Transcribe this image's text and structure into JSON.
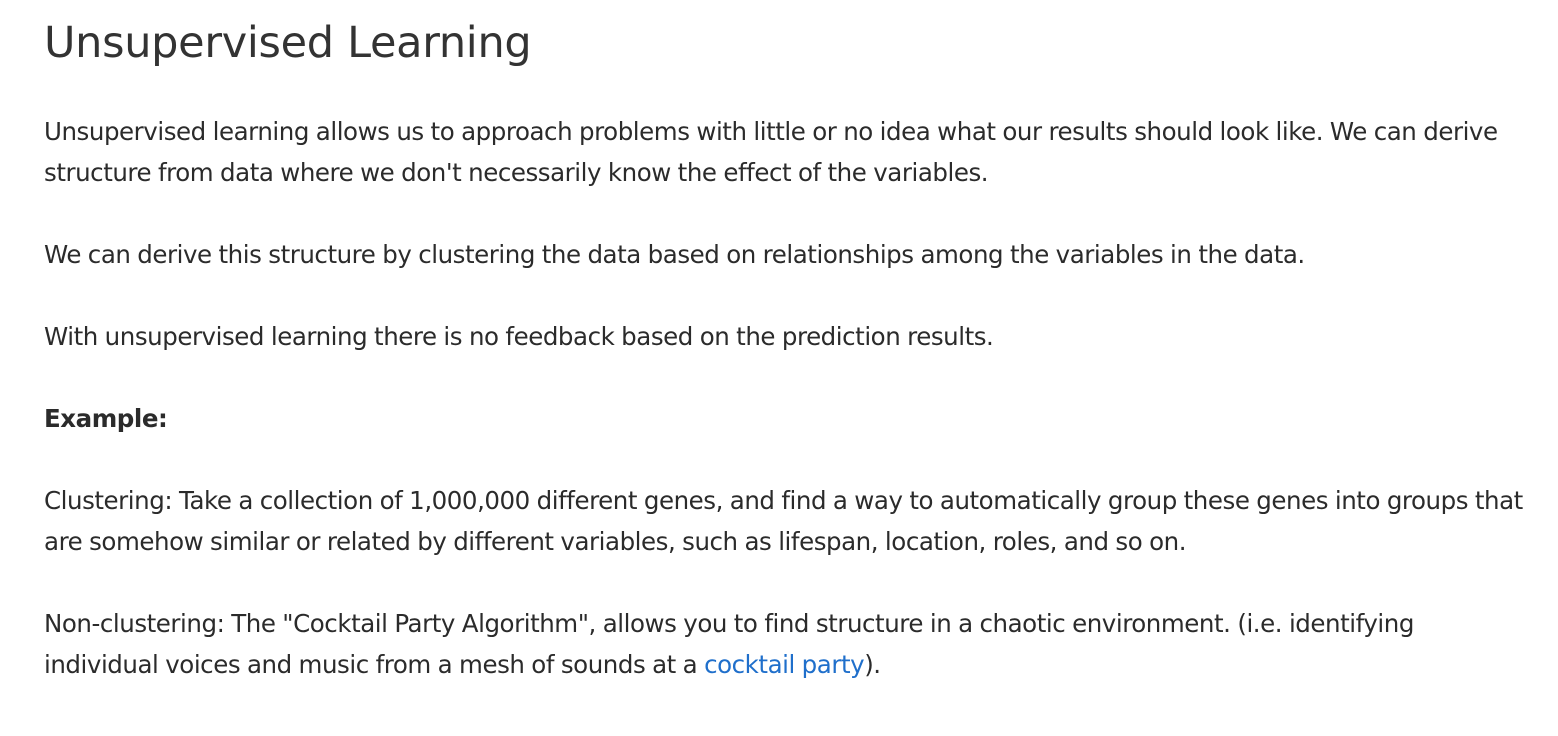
{
  "heading": "Unsupervised Learning",
  "paragraphs": {
    "intro": "Unsupervised learning allows us to approach problems with little or no idea what our results should look like. We can derive structure from data where we don't necessarily know the effect of the variables.",
    "structure": "We can derive this structure by clustering the data based on relationships among the variables in the data.",
    "feedback": "With unsupervised learning there is no feedback based on the prediction results."
  },
  "example_label": "Example:",
  "clustering": "Clustering: Take a collection of 1,000,000 different genes, and find a way to automatically group these genes into groups that are somehow similar or related by different variables, such as lifespan, location, roles, and so on.",
  "non_clustering": {
    "text_before": "Non-clustering: The \"Cocktail Party Algorithm\", allows you to find structure in a chaotic environment. (i.e. identifying individual voices and music from a mesh of sounds at a ",
    "link_text": "cocktail party",
    "text_after": ").",
    "link_color": "#1f6fcb"
  }
}
